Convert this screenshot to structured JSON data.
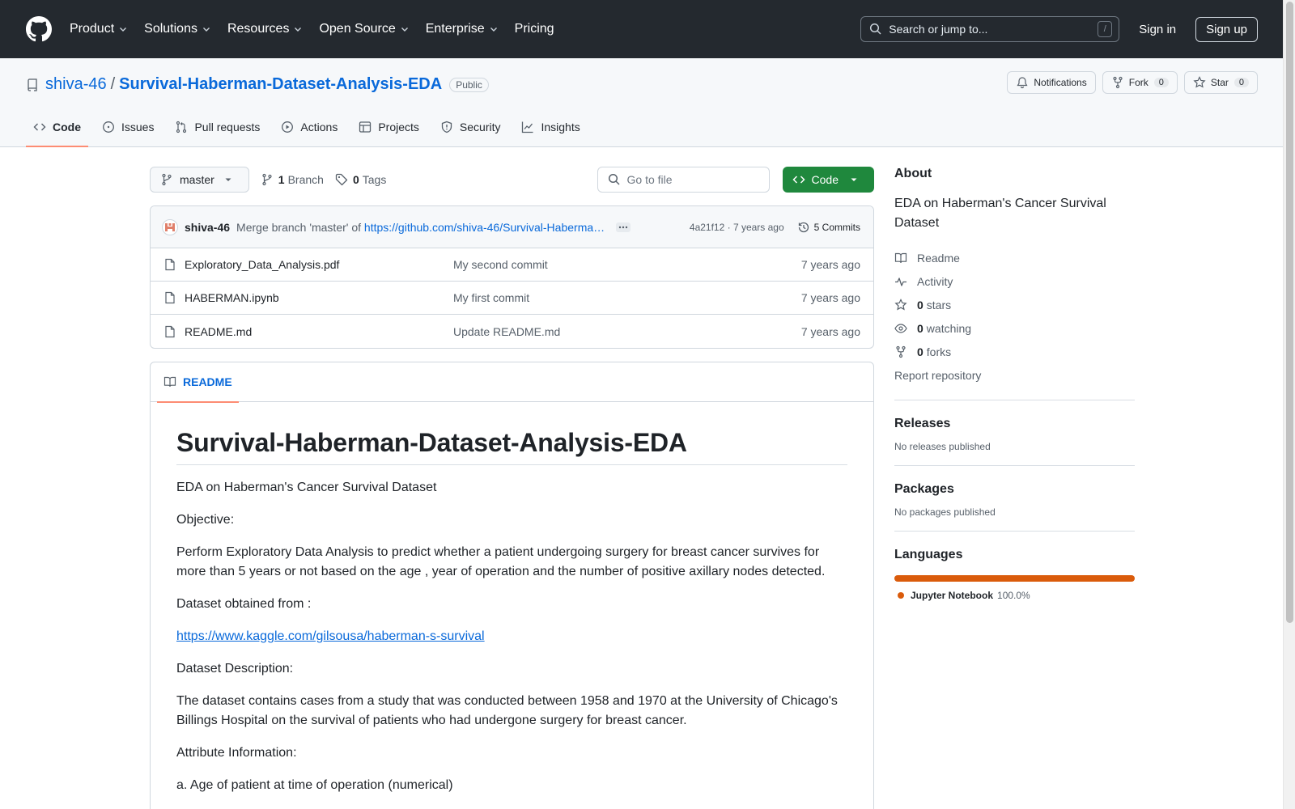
{
  "header": {
    "nav": [
      "Product",
      "Solutions",
      "Resources",
      "Open Source",
      "Enterprise",
      "Pricing"
    ],
    "search_placeholder": "Search or jump to...",
    "search_shortcut": "/",
    "sign_in": "Sign in",
    "sign_up": "Sign up"
  },
  "repo": {
    "owner": "shiva-46",
    "separator": "/",
    "name": "Survival-Haberman-Dataset-Analysis-EDA",
    "visibility": "Public",
    "notifications_label": "Notifications",
    "fork_label": "Fork",
    "fork_count": "0",
    "star_label": "Star",
    "star_count": "0",
    "tabs": [
      "Code",
      "Issues",
      "Pull requests",
      "Actions",
      "Projects",
      "Security",
      "Insights"
    ]
  },
  "toolbar": {
    "branch": "master",
    "branch_count": "1",
    "branch_label": "Branch",
    "tag_count": "0",
    "tag_label": "Tags",
    "goto_placeholder": "Go to file",
    "code_button": "Code"
  },
  "latest_commit": {
    "author": "shiva-46",
    "message_prefix": "Merge branch 'master' of ",
    "message_link": "https://github.com/shiva-46/Survival-Haberma…",
    "hash_time": "4a21f12 · 7 years ago",
    "commits_count": "5 Commits"
  },
  "files": [
    {
      "name": "Exploratory_Data_Analysis.pdf",
      "message": "My second commit",
      "age": "7 years ago"
    },
    {
      "name": "HABERMAN.ipynb",
      "message": "My first commit",
      "age": "7 years ago"
    },
    {
      "name": "README.md",
      "message": "Update README.md",
      "age": "7 years ago"
    }
  ],
  "readme": {
    "tab_label": "README",
    "title": "Survival-Haberman-Dataset-Analysis-EDA",
    "paragraphs": [
      "EDA on Haberman's Cancer Survival Dataset",
      "Objective:",
      "Perform Exploratory Data Analysis to predict whether a patient undergoing surgery for breast cancer survives for more than 5 years or not based on the age , year of operation and the number of positive axillary nodes detected.",
      "Dataset obtained from :",
      "https://www.kaggle.com/gilsousa/haberman-s-survival",
      "Dataset Description:",
      "The dataset contains cases from a study that was conducted between 1958 and 1970 at the University of Chicago's Billings Hospital on the survival of patients who had undergone surgery for breast cancer.",
      "Attribute Information:",
      "a. Age of patient at time of operation (numerical)"
    ]
  },
  "sidebar": {
    "about_title": "About",
    "description": "EDA on Haberman's Cancer Survival Dataset",
    "readme_link": "Readme",
    "activity_link": "Activity",
    "stars_count": "0",
    "stars_label": "stars",
    "watching_count": "0",
    "watching_label": "watching",
    "forks_count": "0",
    "forks_label": "forks",
    "report": "Report repository",
    "releases_title": "Releases",
    "releases_sub": "No releases published",
    "packages_title": "Packages",
    "packages_sub": "No packages published",
    "languages_title": "Languages",
    "language_name": "Jupyter Notebook",
    "language_pct": "100.0%",
    "language_share": 1.0,
    "language_color": "#da5b0b"
  },
  "colors": {
    "header_bg": "#24292f",
    "link": "#0969da",
    "code_button": "#1f883d",
    "tab_underline": "#fd8c73"
  }
}
